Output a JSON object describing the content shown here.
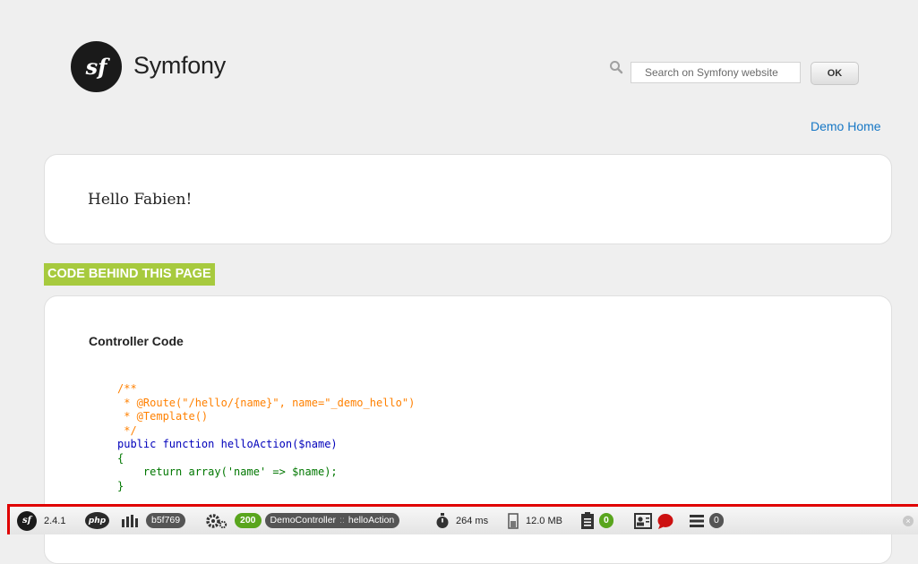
{
  "header": {
    "logo_text": "sf",
    "brand": "Symfony",
    "search": {
      "placeholder": "Search on Symfony website",
      "value": ""
    },
    "ok_label": "OK",
    "nav_link": "Demo Home"
  },
  "greeting": "Hello Fabien!",
  "code_section": {
    "banner": "CODE BEHIND THIS PAGE",
    "title": "Controller Code",
    "lines": [
      "/**",
      " * @Route(\"/hello/{name}\", name=\"_demo_hello\")",
      " * @Template()",
      " */",
      "public function helloAction($name)",
      "{",
      "    return array('name' => $name);",
      "}"
    ]
  },
  "toolbar": {
    "version": "2.4.1",
    "php_label": "php",
    "token": "b5f769",
    "status": "200",
    "controller": "DemoController",
    "controller_sep": "::",
    "action": "helloAction",
    "time": "264 ms",
    "memory": "12.0 MB",
    "logs_count": "0",
    "db_count": "0"
  },
  "colors": {
    "accent_green": "#a7ca3e",
    "link_blue": "#1677c5",
    "toolbar_border": "#e00000",
    "status_green": "#59a51d"
  }
}
